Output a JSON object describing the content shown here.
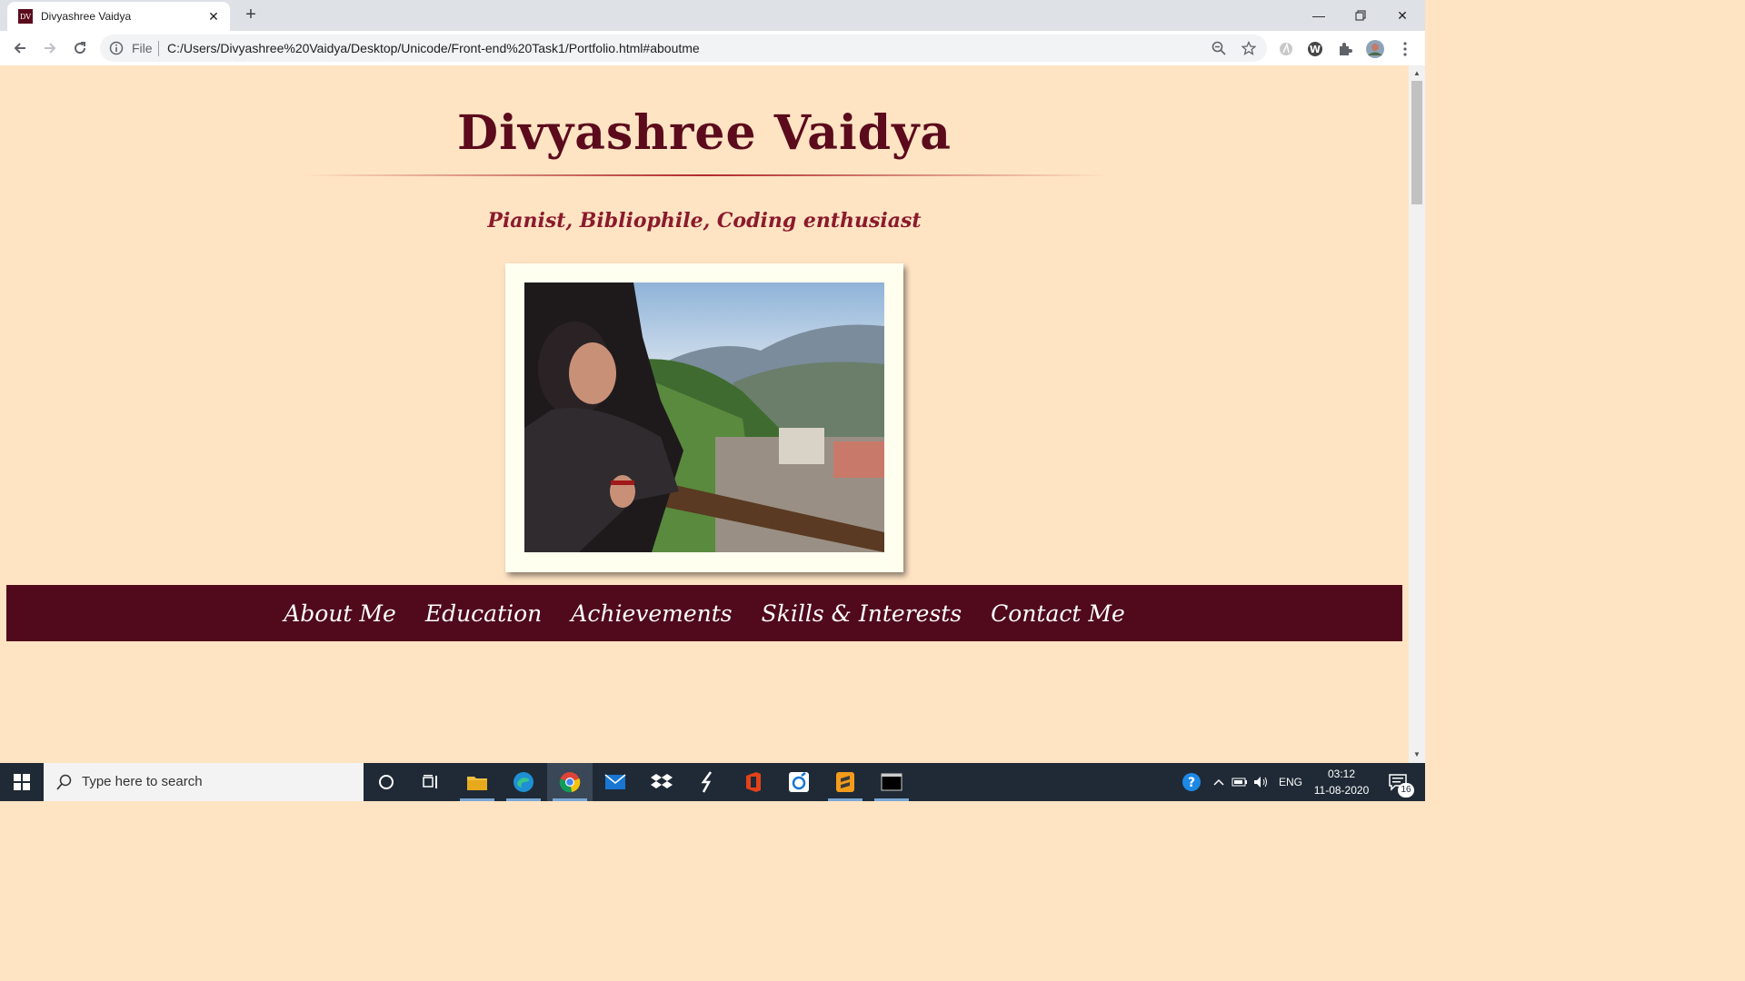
{
  "browser": {
    "tab": {
      "favicon_text": "DV",
      "title": "Divyashree Vaidya"
    },
    "omnibox": {
      "scheme_label": "File",
      "url": "C:/Users/Divyashree%20Vaidya/Desktop/Unicode/Front-end%20Task1/Portfolio.html#aboutme"
    }
  },
  "page": {
    "title": "Divyashree Vaidya",
    "tagline": "Pianist, Bibliophile, Coding enthusiast",
    "photo_alt": "Portrait at a hill station balcony",
    "nav": [
      "About Me",
      "Education",
      "Achievements",
      "Skills & Interests",
      "Contact Me"
    ],
    "colors": {
      "background": "#ffe4c4",
      "accent": "#500a1c",
      "title": "#5b0b1c",
      "frame": "#fffff0"
    }
  },
  "taskbar": {
    "search_placeholder": "Type here to search",
    "apps": [
      "cortana-icon",
      "task-view-icon",
      "file-explorer-icon",
      "edge-icon",
      "chrome-icon",
      "mail-icon",
      "dropbox-icon",
      "app-s-icon",
      "office-icon",
      "app-blue-icon",
      "sublime-text-icon",
      "terminal-icon"
    ],
    "language": "ENG",
    "time": "03:12",
    "date": "11-08-2020",
    "notification_count": "16"
  }
}
